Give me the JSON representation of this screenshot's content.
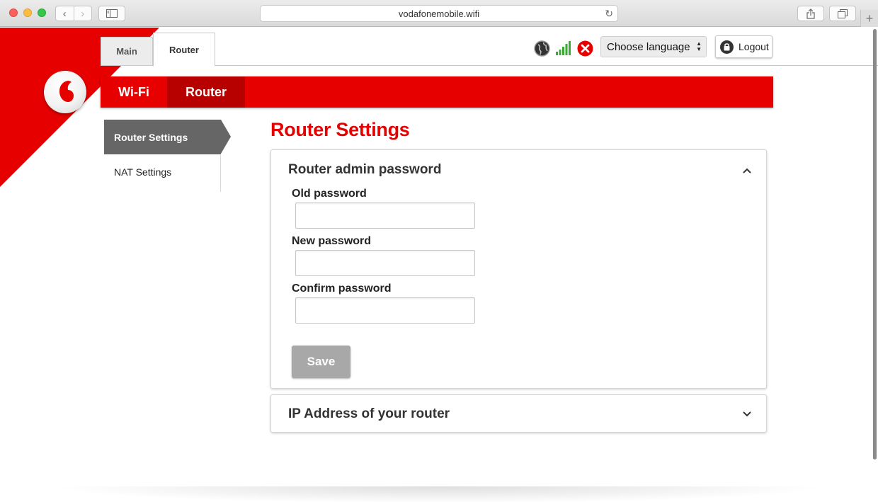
{
  "browser": {
    "url": "vodafonemobile.wifi",
    "back_glyph": "‹",
    "forward_glyph": "›",
    "reload_glyph": "↻",
    "new_tab_glyph": "+"
  },
  "colors": {
    "brand_red": "#e60000",
    "active_nav_red": "#b70000",
    "side_active_gray": "#666666",
    "save_disabled_gray": "#a8a8a8",
    "signal_green": "#3aa935"
  },
  "top_tabs": [
    {
      "label": "Main",
      "active": false
    },
    {
      "label": "Router",
      "active": true
    }
  ],
  "status": {
    "icons": [
      "globe-icon",
      "signal-bars-icon",
      "error-x-icon"
    ]
  },
  "language": {
    "selected": "Choose language"
  },
  "logout": {
    "label": "Logout",
    "icon": "lock-icon"
  },
  "red_nav": {
    "items": [
      {
        "label": "Wi-Fi",
        "active": false
      },
      {
        "label": "Router",
        "active": true
      }
    ]
  },
  "side_menu": {
    "items": [
      {
        "label": "Router Settings",
        "active": true
      },
      {
        "label": "NAT Settings",
        "active": false
      }
    ]
  },
  "main": {
    "title": "Router Settings",
    "panels": [
      {
        "title": "Router admin password",
        "expanded": true,
        "fields": [
          {
            "label": "Old password",
            "value": ""
          },
          {
            "label": "New password",
            "value": ""
          },
          {
            "label": "Confirm password",
            "value": ""
          }
        ],
        "save_label": "Save"
      },
      {
        "title": "IP Address of your router",
        "expanded": false
      }
    ]
  }
}
